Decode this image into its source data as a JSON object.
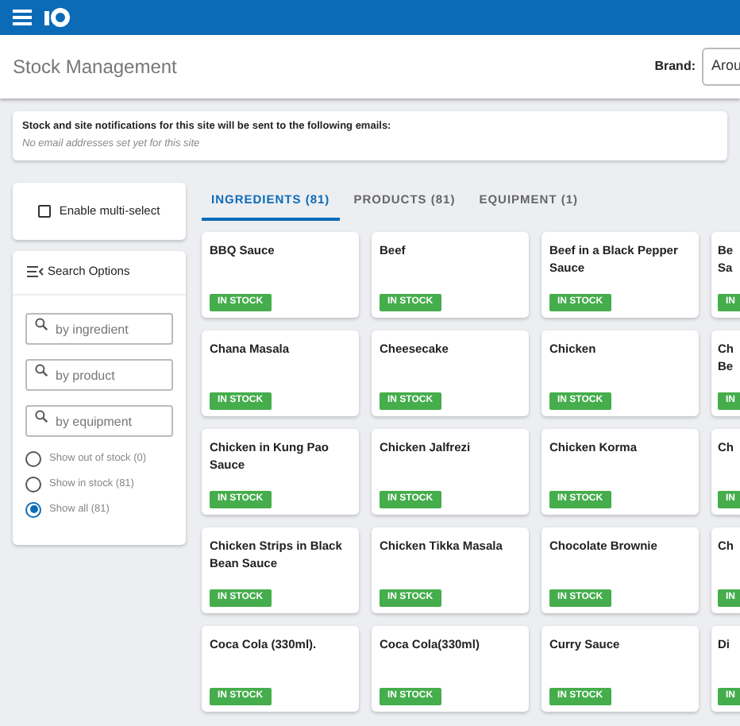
{
  "page_title": "Stock Management",
  "brand": {
    "label": "Brand:",
    "value": "Arou"
  },
  "notification": {
    "heading": "Stock and site notifications for this site will be sent to the following emails:",
    "note": "No email addresses set yet for this site"
  },
  "multi_select": {
    "label": "Enable multi-select",
    "checked": false
  },
  "search_options": {
    "title": "Search Options",
    "fields": [
      {
        "placeholder": "by ingredient"
      },
      {
        "placeholder": "by product"
      },
      {
        "placeholder": "by equipment"
      }
    ],
    "filters": [
      {
        "label": "Show out of stock (0)",
        "selected": false
      },
      {
        "label": "Show in stock (81)",
        "selected": false
      },
      {
        "label": "Show all (81)",
        "selected": true
      }
    ]
  },
  "tabs": [
    {
      "label": "INGREDIENTS (81)",
      "selected": true
    },
    {
      "label": "PRODUCTS (81)",
      "selected": false
    },
    {
      "label": "EQUIPMENT (1)",
      "selected": false
    }
  ],
  "items": [
    {
      "name": "BBQ Sauce",
      "status": "IN STOCK"
    },
    {
      "name": "Beef",
      "status": "IN STOCK"
    },
    {
      "name": "Beef in a Black Pepper Sauce",
      "status": "IN STOCK"
    },
    {
      "name": "Be Sa",
      "status": "IN"
    },
    {
      "name": "Chana Masala",
      "status": "IN STOCK"
    },
    {
      "name": "Cheesecake",
      "status": "IN STOCK"
    },
    {
      "name": "Chicken",
      "status": "IN STOCK"
    },
    {
      "name": "Ch Be",
      "status": "IN"
    },
    {
      "name": "Chicken in Kung Pao Sauce",
      "status": "IN STOCK"
    },
    {
      "name": "Chicken Jalfrezi",
      "status": "IN STOCK"
    },
    {
      "name": "Chicken Korma",
      "status": "IN STOCK"
    },
    {
      "name": "Ch",
      "status": "IN"
    },
    {
      "name": "Chicken Strips in Black Bean Sauce",
      "status": "IN STOCK"
    },
    {
      "name": "Chicken Tikka Masala",
      "status": "IN STOCK"
    },
    {
      "name": "Chocolate Brownie",
      "status": "IN STOCK"
    },
    {
      "name": "Ch",
      "status": "IN"
    },
    {
      "name": "Coca Cola (330ml).",
      "status": "IN STOCK"
    },
    {
      "name": "Coca Cola(330ml)",
      "status": "IN STOCK"
    },
    {
      "name": "Curry Sauce",
      "status": "IN STOCK"
    },
    {
      "name": "Di",
      "status": "IN"
    }
  ]
}
